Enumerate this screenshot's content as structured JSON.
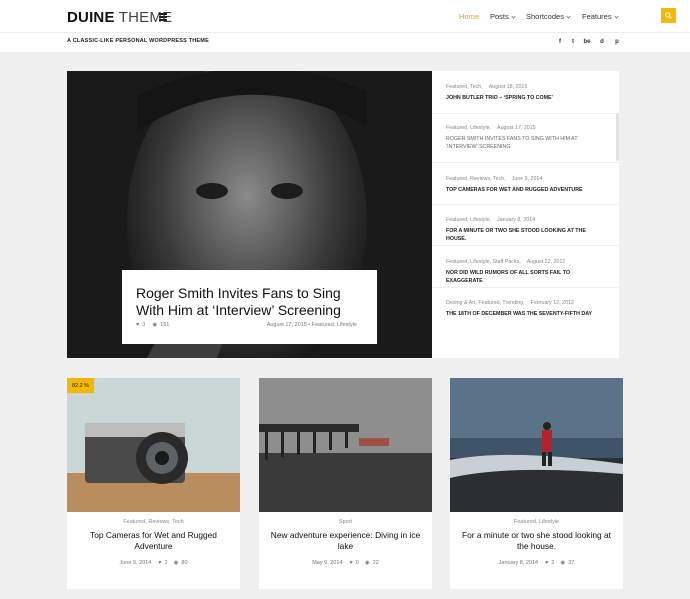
{
  "header": {
    "logo_bold": "DUINE",
    "logo_light": "THEME",
    "tagline": "A CLASSIC-LIKE PERSONAL WORDPRESS THEME",
    "nav": [
      {
        "label": "Home",
        "active": true
      },
      {
        "label": "Posts",
        "dropdown": true
      },
      {
        "label": "Shortcodes",
        "dropdown": true
      },
      {
        "label": "Features",
        "dropdown": true
      }
    ],
    "social": [
      "f",
      "t",
      "be",
      "d",
      "p"
    ],
    "accent": "#f5b800",
    "active_nav_color": "#f0a500"
  },
  "hero": {
    "title": "Roger Smith Invites Fans to Sing With Him at ‘Interview’ Screening",
    "likes": "3",
    "views": "151",
    "date_cats": "August 17, 2015 • Featured, Lifestyle"
  },
  "sidebar": {
    "items": [
      {
        "cats": "Featured, Tech,",
        "date": "August 18, 2015",
        "title": "JOHN BUTLER TRIO – ‘SPRING TO COME’"
      },
      {
        "cats": "Featured, Lifestyle,",
        "date": "August 17, 2015",
        "title": "ROGER SMITH INVITES FANS TO SING WITH HIM AT ‘INTERVIEW’ SCREENING"
      },
      {
        "cats": "Featured, Reviews, Tech,",
        "date": "June 9, 2014",
        "title": "TOP CAMERAS FOR WET AND RUGGED ADVENTURE"
      },
      {
        "cats": "Featured, Lifestyle,",
        "date": "January 8, 2014",
        "title": "FOR A MINUTE OR TWO SHE STOOD LOOKING AT THE HOUSE."
      },
      {
        "cats": "Featured, Lifestyle, Staff Packs,",
        "date": "August 22, 2012",
        "title": "NOR DID WILD RUMORS OF ALL SORTS FAIL TO EXAGGERATE"
      },
      {
        "cats": "Desing & Art, Featured, Trending,",
        "date": "February 12, 2012",
        "title": "THE 18TH OF DECEMBER WAS THE SEVENTY-FIFTH DAY"
      }
    ]
  },
  "cards": [
    {
      "badge": "82.2 %",
      "cats": "Featured, Reviews, Tech",
      "title": "Top Cameras for Wet and Rugged Adventure",
      "date": "June 9, 2014",
      "likes": "2",
      "views": "80"
    },
    {
      "cats": "Sport",
      "title": "New adventure experience: Diving in ice lake",
      "date": "May 9, 2014",
      "likes": "0",
      "views": "22"
    },
    {
      "cats": "Featured, Lifestyle",
      "title": "For a minute or two she stood looking at the house.",
      "date": "January 8, 2014",
      "likes": "2",
      "views": "37"
    }
  ]
}
